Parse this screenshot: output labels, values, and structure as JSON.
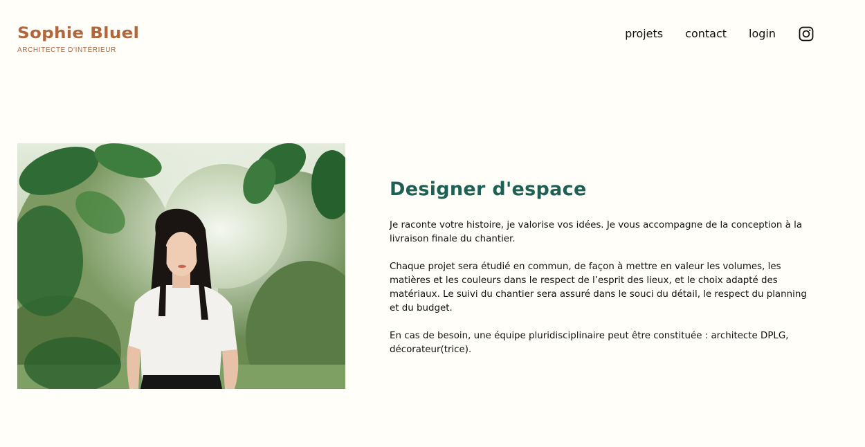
{
  "header": {
    "logo_name": "Sophie Bluel",
    "logo_subtitle": "ARCHITECTE D'INTÉRIEUR",
    "nav": {
      "projets": "projets",
      "contact": "contact",
      "login": "login"
    },
    "social_icon": "instagram-icon"
  },
  "intro": {
    "photo": "portrait of woman in white top standing among trees",
    "title": "Designer d'espace",
    "paragraphs": [
      "Je raconte votre histoire, je valorise vos idées. Je vous accompagne de la conception à la livraison finale du chantier.",
      "Chaque projet sera étudié en commun, de façon à mettre en valeur les volumes, les matières et les couleurs dans le respect de l’esprit des lieux, et le choix adapté des matériaux. Le suivi du chantier sera assuré dans le souci du détail, le respect du planning et du budget.",
      "En cas de besoin, une équipe pluridisciplinaire peut être constituée : architecte DPLG, décorateur(trice)."
    ]
  },
  "colors": {
    "background": "#FFFEF8",
    "brand": "#B1663C",
    "title": "#1D6154"
  }
}
